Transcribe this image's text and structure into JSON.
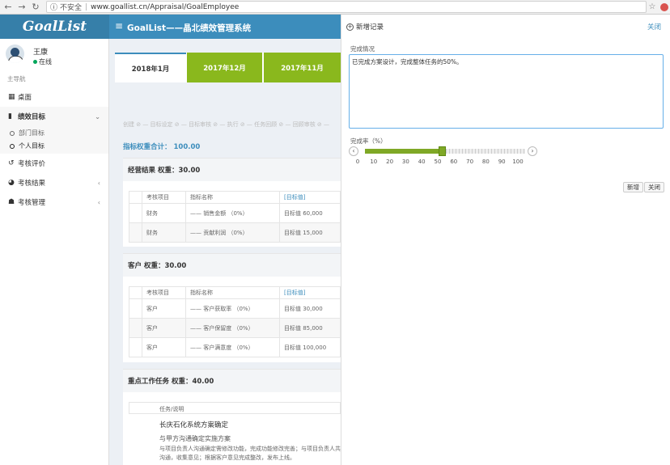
{
  "browser": {
    "insecure_label": "不安全",
    "url": "www.goallist.cn/Appraisal/GoalEmployee"
  },
  "header": {
    "logo": "GoalList",
    "system_title": "GoalList——晶北绩效管理系统"
  },
  "user": {
    "name": "王康",
    "status": "在线"
  },
  "sidebar": {
    "section_label": "主导航",
    "items": [
      {
        "label": "桌面",
        "icon": "desktop-icon"
      },
      {
        "label": "绩效目标",
        "icon": "book-icon"
      },
      {
        "label": "考核评价",
        "icon": "refresh-icon"
      },
      {
        "label": "考核结果",
        "icon": "pie-icon"
      },
      {
        "label": "考核管理",
        "icon": "users-icon"
      }
    ],
    "subitems": [
      {
        "label": "部门目标"
      },
      {
        "label": "个人目标"
      }
    ]
  },
  "tabs": [
    "2018年1月",
    "2017年12月",
    "2017年11月"
  ],
  "steps_text": "创建 ⊘ — 目标设定 ⊘ — 目标审核 ⊘ — 执行 ⊘ — 任务回顾 ⊘ — 回顾审核 ⊘ —",
  "weight_total": {
    "label": "指标权重合计：",
    "value": "100.00"
  },
  "tables": {
    "headers": [
      "考核项目",
      "指标名称",
      "[目标值]"
    ],
    "sections": [
      {
        "title": "经营结果  权重：30.00",
        "rows": [
          [
            "财务",
            "—— 销售金额 （0%）",
            "目标值 60,000"
          ],
          [
            "财务",
            "—— 贡献利润 （0%）",
            "目标值 15,000"
          ]
        ]
      },
      {
        "title": "客户  权重：30.00",
        "rows": [
          [
            "客户",
            "—— 客户获取率 （0%）",
            "目标值 30,000"
          ],
          [
            "客户",
            "—— 客户保留度 （0%）",
            "目标值 85,000"
          ],
          [
            "客户",
            "—— 客户满意度 （0%）",
            "目标值 100,000"
          ]
        ]
      }
    ]
  },
  "tasks": {
    "title": "重点工作任务  权重：40.00",
    "header": "任务/说明",
    "task_title": "长庆石化系统方案确定",
    "task_sub": "与甲方沟通确定实施方案",
    "task_desc": "与项目负责人沟通确定需修改功能，完成功能修改完善；与项目负责人共同向 沟通，收集意见；根据客户意见完成整改，发布上线。"
  },
  "panel": {
    "title": "新增记录",
    "close_label": "关闭",
    "completion_label": "完成情况",
    "completion_text": "已完成方案设计，完成整体任务的50%。",
    "rate_label": "完成率（%）",
    "rate_value": 48,
    "ticks": [
      "0",
      "10",
      "20",
      "30",
      "40",
      "50",
      "60",
      "70",
      "80",
      "90",
      "100"
    ],
    "add_button": "新增",
    "close_button": "关闭"
  }
}
